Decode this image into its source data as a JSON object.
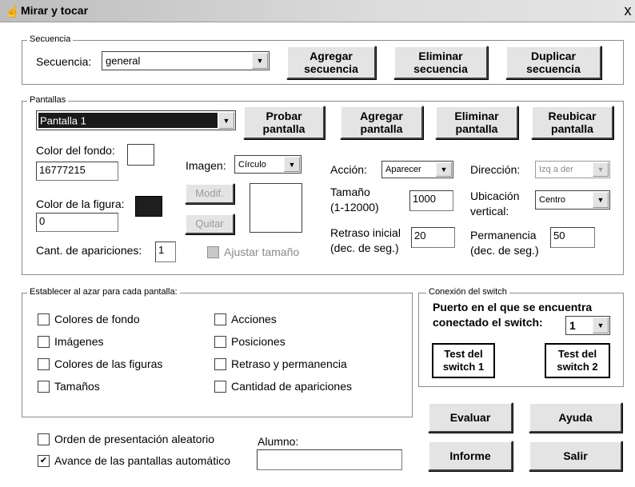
{
  "window": {
    "title": "Mirar y tocar",
    "close": "x",
    "app_icon": "hand-icon"
  },
  "secuencia": {
    "legend": "Secuencia",
    "label": "Secuencia:",
    "value": "general",
    "buttons": {
      "agregar": "Agregar secuencia",
      "eliminar": "Eliminar secuencia",
      "duplicar": "Duplicar secuencia"
    }
  },
  "pantallas": {
    "legend": "Pantallas",
    "selected": "Pantalla 1",
    "buttons": {
      "probar": "Probar pantalla",
      "agregar": "Agregar pantalla",
      "eliminar": "Eliminar pantalla",
      "reubicar": "Reubicar pantalla"
    },
    "color_fondo": {
      "label": "Color del fondo:",
      "value": "16777215"
    },
    "color_figura": {
      "label": "Color de la figura:",
      "value": "0"
    },
    "cant_apariciones": {
      "label": "Cant. de apariciones:",
      "value": "1"
    },
    "imagen": {
      "label": "Imagen:",
      "value": "Círculo"
    },
    "modif": "Modif.",
    "quitar": "Quitar",
    "ajustar": "Ajustar tamaño",
    "accion": {
      "label": "Acción:",
      "value": "Aparecer"
    },
    "direccion": {
      "label": "Dirección:",
      "value": "Izq a der"
    },
    "tamano": {
      "label1": "Tamaño",
      "label2": "(1-12000)",
      "value": "1000"
    },
    "ubicacion": {
      "label1": "Ubicación",
      "label2": "vertical:",
      "value": "Centro"
    },
    "retraso": {
      "label1": "Retraso inicial",
      "label2": "(dec. de seg.)",
      "value": "20"
    },
    "permanencia": {
      "label1": "Permanencia",
      "label2": "(dec. de seg.)",
      "value": "50"
    }
  },
  "azar": {
    "legend": "Establecer al azar para cada pantalla:",
    "items": [
      "Colores de fondo",
      "Imágenes",
      "Colores de las figuras",
      "Tamaños",
      "Acciones",
      "Posiciones",
      "Retraso y permanencia",
      "Cantidad de apariciones"
    ]
  },
  "switch": {
    "legend": "Conexión del switch",
    "puerto_line1": "Puerto en el que se encuentra",
    "puerto_line2": "conectado el switch:",
    "puerto_value": "1",
    "test1": "Test del switch 1",
    "test2": "Test del switch 2"
  },
  "opciones": {
    "orden": "Orden de presentación aleatorio",
    "avance": "Avance de las pantallas automático",
    "avance_checked": "✔",
    "alumno_label": "Alumno:"
  },
  "acciones": {
    "evaluar": "Evaluar",
    "ayuda": "Ayuda",
    "informe": "Informe",
    "salir": "Salir"
  }
}
